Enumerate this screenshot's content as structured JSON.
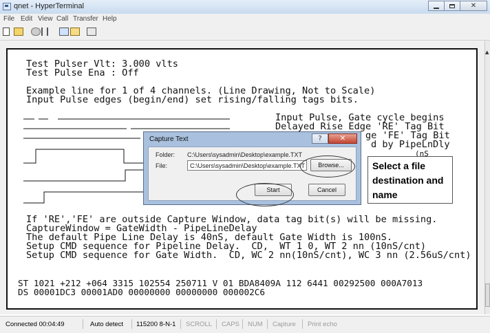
{
  "window": {
    "title": "qnet - HyperTerminal"
  },
  "menu": [
    "File",
    "Edit",
    "View",
    "Call",
    "Transfer",
    "Help"
  ],
  "toolbar": [
    {
      "icon": "new-document-icon"
    },
    {
      "icon": "open-folder-icon"
    },
    {
      "icon": "disconnect-icon"
    },
    {
      "icon": "hangup-icon"
    },
    {
      "icon": "send-file-icon"
    },
    {
      "icon": "receive-file-icon"
    },
    {
      "icon": "properties-icon"
    }
  ],
  "terminal": {
    "lines_top": [
      "Test Pulser Vlt: 3.000 vlts",
      "Test Pulse Ena : Off",
      "",
      "Example line for 1 of 4 channels. (Line Drawing, Not to Scale)",
      "Input Pulse edges (begin/end) set rising/falling tags bits."
    ],
    "right_labels": [
      "Input Pulse, Gate cycle begins",
      "Delayed Rise Edge 'RE' Tag Bit",
      "ge 'FE' Tag Bit",
      "d by PipeLnDly",
      "(nS"
    ],
    "lines_bottom": [
      "If 'RE','FE' are outside Capture Window, data tag bit(s) will be missing.",
      "CaptureWindow = GateWidth - PipeLineDelay",
      "The default Pipe Line Delay is 40nS, default Gate Width is 100nS.",
      "Setup CMD sequence for Pipeline Delay.  CD,  WT 1 0, WT 2 nn (10nS/cnt)",
      "Setup CMD sequence for Gate Width.  CD, WC 2 nn(10nS/cnt), WC 3 nn (2.56uS/cnt)"
    ],
    "lines_data": [
      "ST 1021 +212 +064 3315 102554 250711 V 01 BDA8409A 112 6441 00292500 000A7013",
      "DS 00001DC3 00001AD0 00000000 00000000 000002C6"
    ]
  },
  "dialog": {
    "title": "Capture Text",
    "help_label": "?",
    "close_label": "✕",
    "folder_label": "Folder:",
    "folder_value": "C:\\Users\\sysadmin\\Desktop\\example.TXT",
    "file_label": "File:",
    "file_value": "C:\\Users\\sysadmin\\Desktop\\example.TXT",
    "browse_label": "Browse...",
    "start_label": "Start",
    "cancel_label": "Cancel"
  },
  "callout": {
    "lines": [
      "Select a file",
      "destination and",
      "name"
    ]
  },
  "statusbar": {
    "connected": "Connected 00:04:49",
    "detect": "Auto detect",
    "params": "115200 8-N-1",
    "scroll": "SCROLL",
    "caps": "CAPS",
    "num": "NUM",
    "capture": "Capture",
    "print": "Print echo"
  }
}
